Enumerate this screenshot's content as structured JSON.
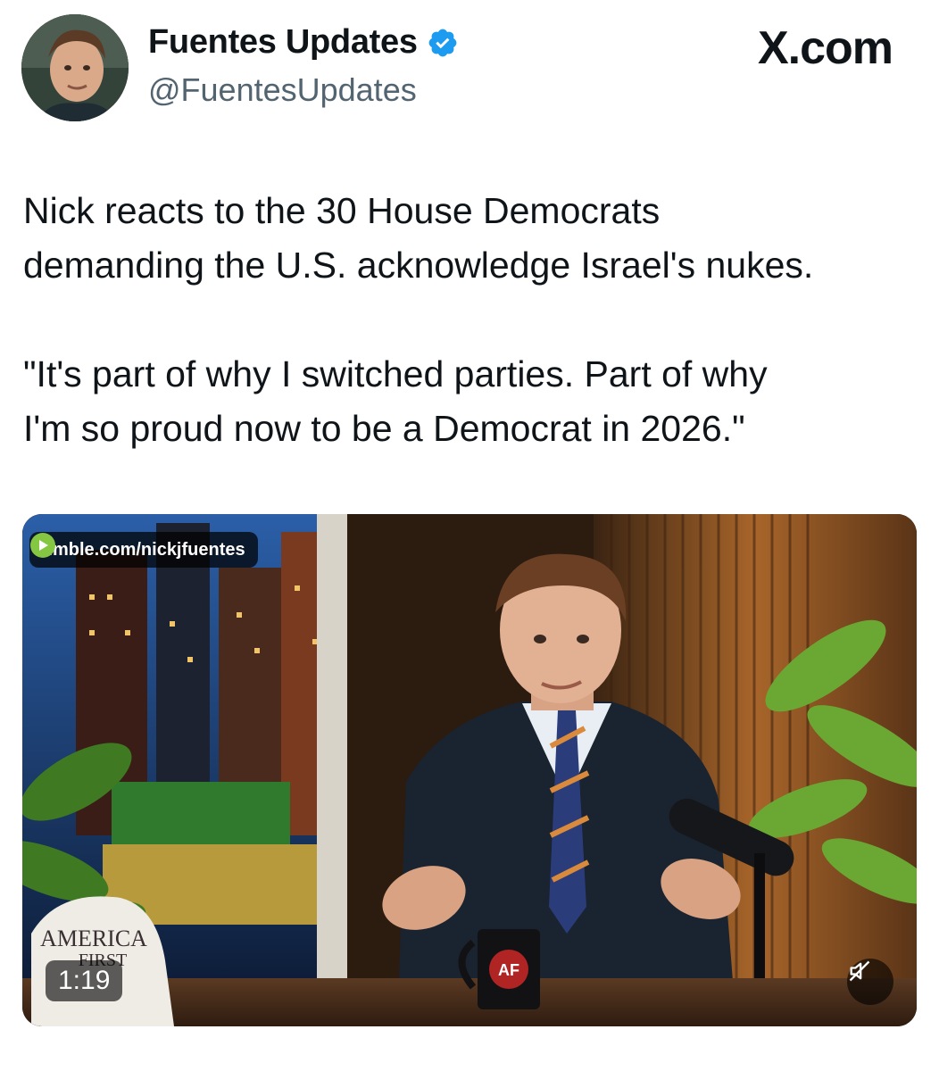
{
  "author": {
    "display_name": "Fuentes Updates",
    "handle": "@FuentesUpdates",
    "verified_icon": "verified-badge-icon",
    "avatar_icon": "profile-photo"
  },
  "site": {
    "label": "X.com"
  },
  "tweet": {
    "text": "Nick reacts to the 30 House Democrats\ndemanding the U.S. acknowledge Israel's nukes.\n\n\"It's part of why I switched parties. Part of why\nI'm so proud now to be a Democrat in 2026.\""
  },
  "media": {
    "source_icon": "rumble-icon",
    "source_label": "rumble.com/nickjfuentes",
    "duration": "1:19",
    "mute_icon": "muted-speaker-icon",
    "hat_text_1": "AMERICA",
    "hat_text_2": "FIRST",
    "mug_text": "AF"
  },
  "colors": {
    "verified_blue": "#1d9bf0",
    "handle_gray": "#536471",
    "rumble_green": "#85c742"
  }
}
